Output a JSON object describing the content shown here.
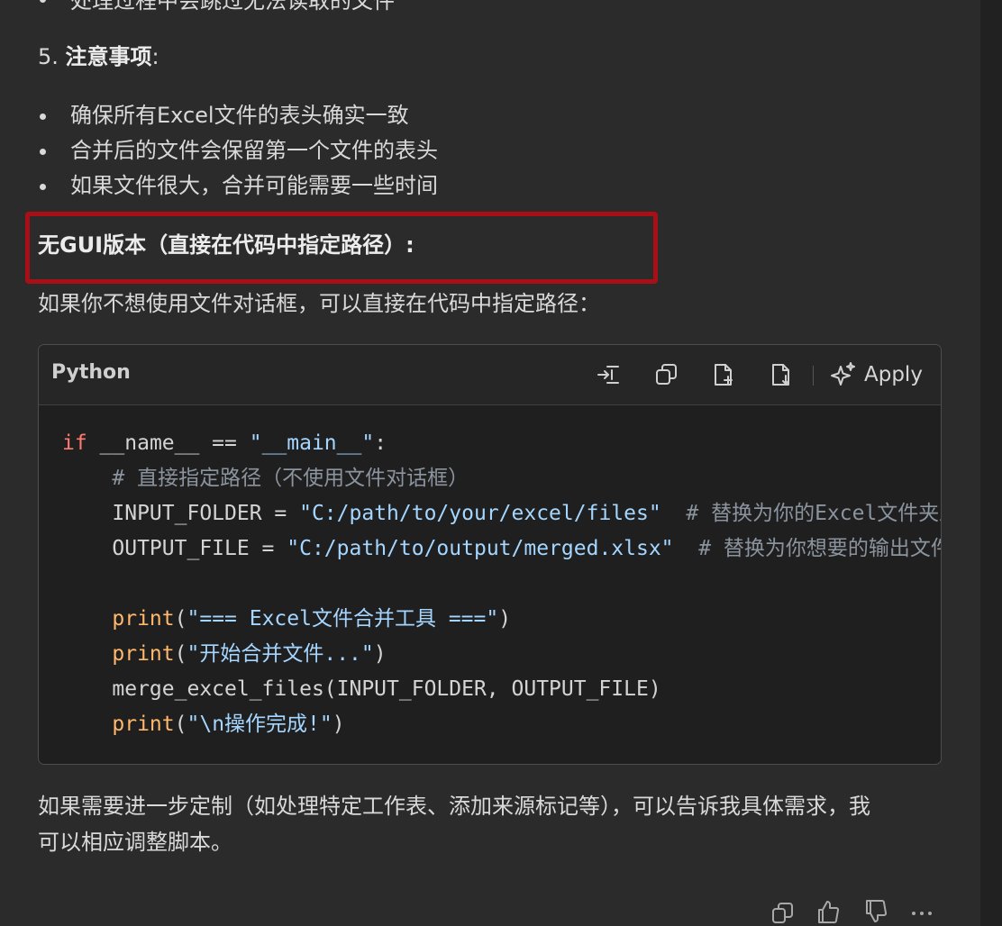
{
  "top_partial_bullet": "处理过程中会跳过无法读取的文件",
  "section5": {
    "number": "5.",
    "title": "注意事项",
    "colon": ":"
  },
  "notes": [
    "确保所有Excel文件的表头确实一致",
    "合并后的文件会保留第一个文件的表头",
    "如果文件很大，合并可能需要一些时间"
  ],
  "highlighted_heading": "无GUI版本（直接在代码中指定路径）:",
  "intro_line": "如果你不想使用文件对话框，可以直接在代码中指定路径：",
  "code_block": {
    "language": "Python",
    "toolbar": {
      "insert_label": "insert-at-cursor",
      "copy_label": "copy",
      "new_file_label": "new-file",
      "save_label": "save",
      "apply_label": "Apply"
    },
    "lines": {
      "l1_kw": "if",
      "l1_rest": " __name__ == ",
      "l1_str": "\"__main__\"",
      "l1_end": ":",
      "l2_comment": "# 直接指定路径（不使用文件对话框）",
      "l3_var": "INPUT_FOLDER = ",
      "l3_str": "\"C:/path/to/your/excel/files\"",
      "l3_comment": "  # 替换为你的Excel文件夹路径",
      "l4_var": "OUTPUT_FILE = ",
      "l4_str": "\"C:/path/to/output/merged.xlsx\"",
      "l4_comment": "  # 替换为你想要的输出文件路径",
      "l6_fn": "print",
      "l6_open": "(",
      "l6_str": "\"=== Excel文件合并工具 ===\"",
      "l6_close": ")",
      "l7_fn": "print",
      "l7_open": "(",
      "l7_str": "\"开始合并文件...\"",
      "l7_close": ")",
      "l8_text": "merge_excel_files(INPUT_FOLDER, OUTPUT_FILE)",
      "l9_fn": "print",
      "l9_open": "(",
      "l9_str": "\"\\n操作完成!\"",
      "l9_close": ")"
    }
  },
  "closing_paragraph_line1": "如果需要进一步定制（如处理特定工作表、添加来源标记等），可以告诉我具体需求，我",
  "closing_paragraph_line2": "可以相应调整脚本。",
  "footer": {
    "icons": [
      "copy-icon",
      "thumbs-up-icon",
      "thumbs-down-icon",
      "more-icon"
    ]
  },
  "colors": {
    "background": "#2b2b2b",
    "code_background": "#1f1f1f",
    "highlight_border": "#a80f17",
    "keyword": "#ff7b72",
    "string": "#a5d6ff",
    "comment": "#8b949e",
    "function": "#ffb86c"
  }
}
